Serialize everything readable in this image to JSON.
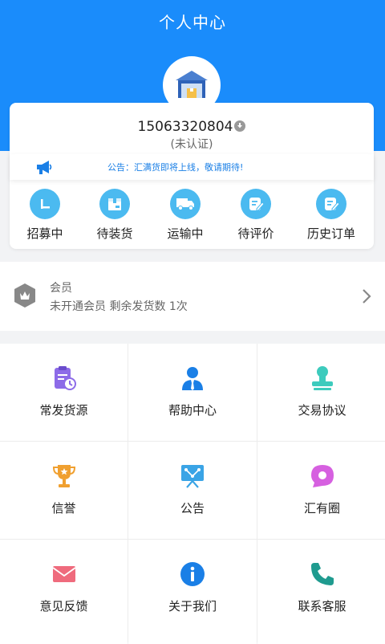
{
  "header": {
    "title": "个人中心",
    "bg_color": "#1a8cfb"
  },
  "profile": {
    "avatar_icon": "warehouse-icon",
    "phone": "15063320804",
    "phone_badge_icon": "down-arrow-badge-icon",
    "verify_status": "(未认证)"
  },
  "notice": {
    "icon": "megaphone-icon",
    "text": "公告：汇满货即将上线，敬请期待!"
  },
  "order_status": {
    "items": [
      {
        "label": "招募中",
        "icon": "recruit-icon"
      },
      {
        "label": "待装货",
        "icon": "box-icon"
      },
      {
        "label": "运输中",
        "icon": "truck-icon"
      },
      {
        "label": "待评价",
        "icon": "review-icon"
      },
      {
        "label": "历史订单",
        "icon": "history-icon"
      }
    ],
    "icon_color": "#4bbaf0"
  },
  "member": {
    "icon": "member-badge-icon",
    "title": "会员",
    "description": "未开通会员 剩余发货数 1次",
    "arrow_icon": "chevron-right-icon"
  },
  "grid": {
    "items": [
      {
        "label": "常发货源",
        "icon": "clipboard-clock-icon",
        "color": "#8d6be8"
      },
      {
        "label": "帮助中心",
        "icon": "user-tie-icon",
        "color": "#1a7fe6"
      },
      {
        "label": "交易协议",
        "icon": "stamp-icon",
        "color": "#3dcbbd"
      },
      {
        "label": "信誉",
        "icon": "trophy-icon",
        "color": "#f0a030"
      },
      {
        "label": "公告",
        "icon": "presentation-icon",
        "color": "#3aa4e6"
      },
      {
        "label": "汇有圈",
        "icon": "chat-bubble-icon",
        "color": "#d660e0"
      },
      {
        "label": "意见反馈",
        "icon": "mail-icon",
        "color": "#ef6b7d"
      },
      {
        "label": "关于我们",
        "icon": "info-icon",
        "color": "#1a7fe6"
      },
      {
        "label": "联系客服",
        "icon": "phone-icon",
        "color": "#1f9b8f"
      }
    ]
  }
}
